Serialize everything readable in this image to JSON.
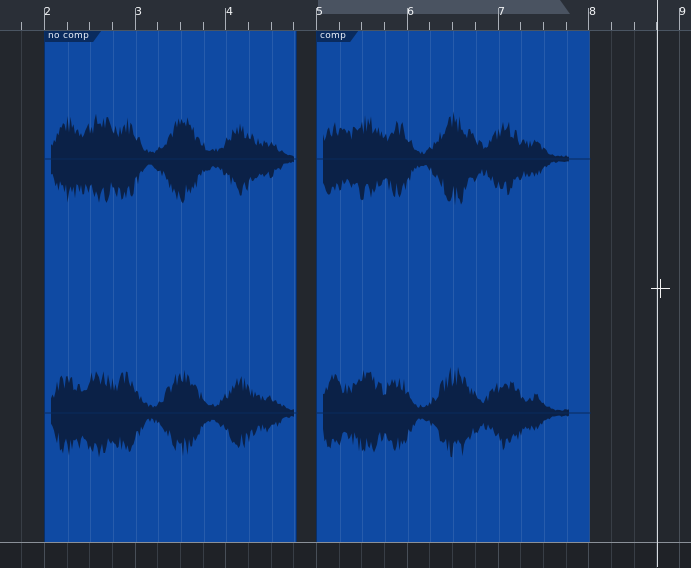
{
  "ruler": {
    "bars": [
      "2",
      "3",
      "4",
      "5",
      "6",
      "7",
      "8",
      "9"
    ]
  },
  "clips": [
    {
      "name": "no comp",
      "color": "#0f4aa3"
    },
    {
      "name": "comp",
      "color": "#0f4aa3"
    }
  ],
  "colors": {
    "clip": "#0f4aa3",
    "waveform": "#0b2147",
    "background": "#23272d"
  }
}
